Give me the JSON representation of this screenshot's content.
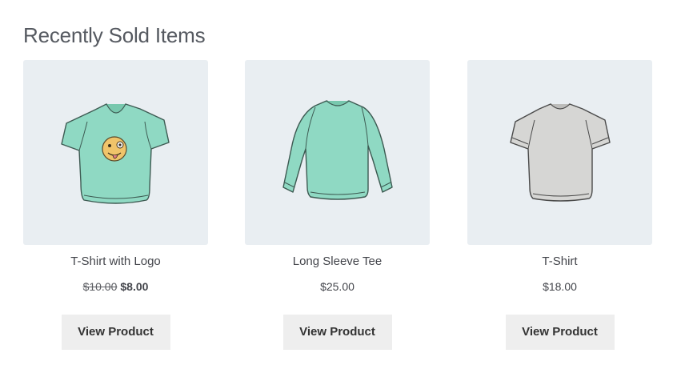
{
  "section": {
    "title": "Recently Sold Items"
  },
  "products": [
    {
      "name": "T-Shirt with Logo",
      "regular_price": "$10.00",
      "sale_price": "$8.00",
      "button_label": "View Product",
      "image_icon": "tshirt-with-logo-icon",
      "image_color": "#8fd9c3"
    },
    {
      "name": "Long Sleeve Tee",
      "price": "$25.00",
      "button_label": "View Product",
      "image_icon": "long-sleeve-tee-icon",
      "image_color": "#8fd9c3"
    },
    {
      "name": "T-Shirt",
      "price": "$18.00",
      "button_label": "View Product",
      "image_icon": "tshirt-icon",
      "image_color": "#d6d6d4"
    }
  ],
  "colors": {
    "thumbnail_bg": "#e9eef2",
    "button_bg": "#eeeeee",
    "text": "#43454b"
  }
}
